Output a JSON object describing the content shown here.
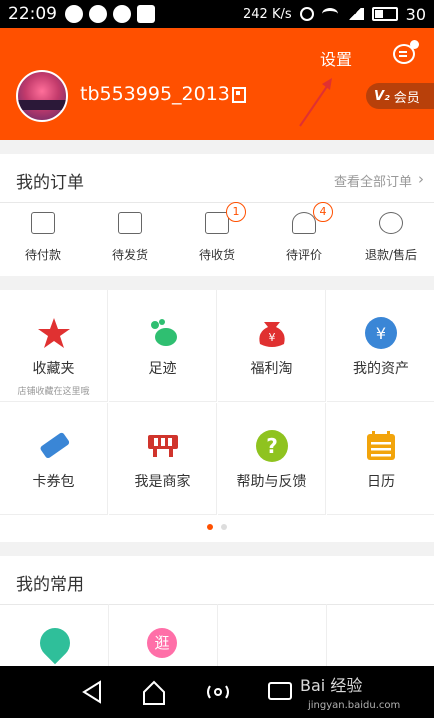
{
  "status_bar": {
    "time": "22:09",
    "data_speed": "242 K/s",
    "battery": "30"
  },
  "header": {
    "username": "tb553995_2013",
    "settings_label": "设置",
    "vip_level": "V₂",
    "vip_label": "会员",
    "brand_color": "#ff5000"
  },
  "orders": {
    "title": "我的订单",
    "view_all": "查看全部订单",
    "items": [
      {
        "label": "待付款",
        "icon": "wallet-icon"
      },
      {
        "label": "待发货",
        "icon": "box-icon"
      },
      {
        "label": "待收货",
        "icon": "truck-icon",
        "badge": "1"
      },
      {
        "label": "待评价",
        "icon": "rate-icon",
        "badge": "4"
      },
      {
        "label": "退款/售后",
        "icon": "refund-icon"
      }
    ]
  },
  "grid": {
    "items": [
      {
        "label": "收藏夹",
        "sub": "店铺收藏在这里哦",
        "icon": "star-icon",
        "color": "#e03131"
      },
      {
        "label": "足迹",
        "sub": "",
        "icon": "footprint-icon",
        "color": "#2fbf71"
      },
      {
        "label": "福利淘",
        "sub": "",
        "icon": "money-bag-icon",
        "color": "#e03131"
      },
      {
        "label": "我的资产",
        "sub": "",
        "icon": "yuan-icon",
        "color": "#3a86d6"
      },
      {
        "label": "卡券包",
        "sub": "",
        "icon": "ticket-icon",
        "color": "#3a86d6"
      },
      {
        "label": "我是商家",
        "sub": "",
        "icon": "shop-icon",
        "color": "#d0342c"
      },
      {
        "label": "帮助与反馈",
        "sub": "",
        "icon": "help-icon",
        "color": "#8fc31f"
      },
      {
        "label": "日历",
        "sub": "",
        "icon": "calendar-icon",
        "color": "#f2a40b"
      }
    ],
    "page_count": 2,
    "active_page": 1
  },
  "common": {
    "title": "我的常用",
    "icon_2_text": "逛"
  },
  "watermark": {
    "text": "Bai 经验",
    "url": "jingyan.baidu.com"
  }
}
